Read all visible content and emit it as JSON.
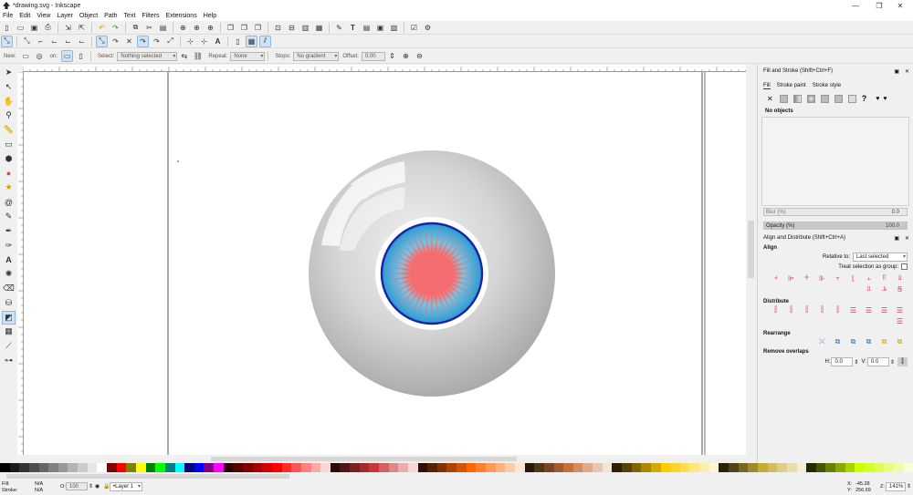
{
  "window": {
    "title": "*drawing.svg - Inkscape",
    "min_glyph": "—",
    "max_glyph": "❐",
    "close_glyph": "✕"
  },
  "menu": [
    "File",
    "Edit",
    "View",
    "Layer",
    "Object",
    "Path",
    "Text",
    "Filters",
    "Extensions",
    "Help"
  ],
  "controls": {
    "new_label": "New:",
    "on_label": "on:",
    "select_label": "Select:",
    "select_value": "Nothing selected",
    "repeat_label": "Repeat:",
    "repeat_value": "None",
    "stops_label": "Stops:",
    "stops_value": "No gradient",
    "offset_label": "Offset:",
    "offset_value": "0.00"
  },
  "fill_stroke": {
    "title": "Fill and Stroke (Shift+Ctrl+F)",
    "tabs": [
      "Fill",
      "Stroke paint",
      "Stroke style"
    ],
    "no_objects": "No objects",
    "blur_label": "Blur (%)",
    "blur_value": "0.0",
    "opacity_label": "Opacity (%)",
    "opacity_value": "100.0"
  },
  "align": {
    "title": "Align and Distribute (Shift+Ctrl+A)",
    "align_header": "Align",
    "relative_label": "Relative to:",
    "relative_value": "Last selected",
    "treat_group_label": "Treat selection as group:",
    "distribute_header": "Distribute",
    "rearrange_header": "Rearrange",
    "remove_overlaps_header": "Remove overlaps",
    "h_label": "H:",
    "h_value": "0.0",
    "v_label": "V:",
    "v_value": "0.0"
  },
  "status": {
    "fill_label": "Fill:",
    "fill_value": "N/A",
    "stroke_label": "Stroke:",
    "stroke_value": "N/A",
    "opacity_label": "O:",
    "opacity_value": "100",
    "layer_value": "•Layer 1",
    "x_label": "X:",
    "x_value": "-45.28",
    "y_label": "Y:",
    "y_value": "256.69",
    "z_label": "Z:",
    "zoom_value": "141%"
  },
  "colors": {
    "eye_white": "#d0d0d0",
    "iris_blue": "#2b9fd6",
    "pupil_red": "#f06a6e",
    "ring_blue": "#1a23a8"
  }
}
